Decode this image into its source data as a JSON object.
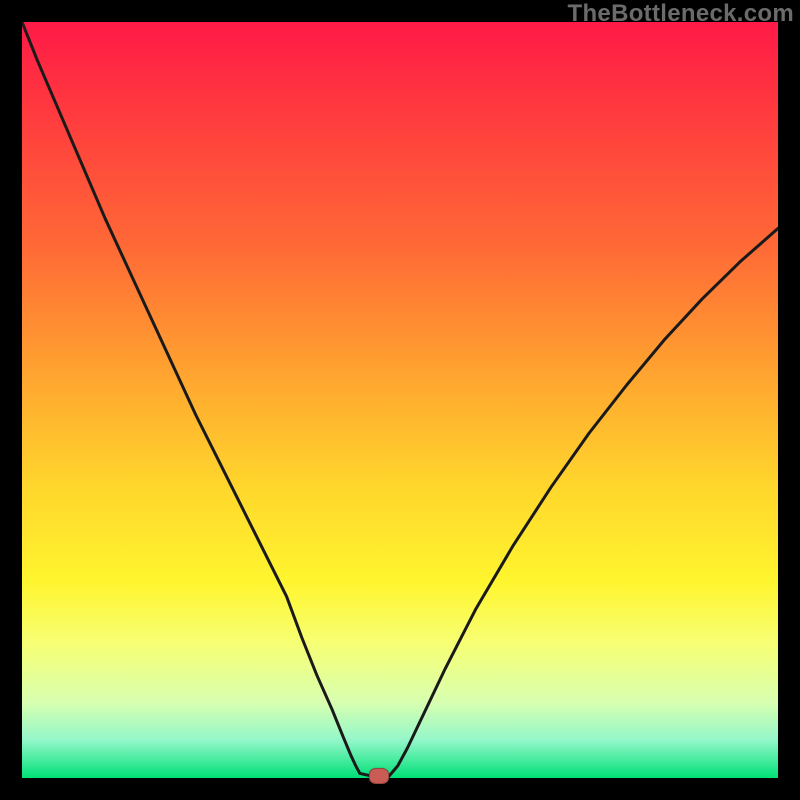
{
  "watermark": "TheBottleneck.com",
  "colors": {
    "gradient_top": "#ff1a47",
    "gradient_bottom": "#00e077",
    "curve_stroke": "#1a1a1a",
    "marker_fill": "#c95c55"
  },
  "chart_data": {
    "type": "line",
    "title": "",
    "xlabel": "",
    "ylabel": "",
    "xlim": [
      0,
      100
    ],
    "ylim": [
      0,
      100
    ],
    "grid": false,
    "legend": false,
    "series": [
      {
        "name": "left-branch",
        "x": [
          0,
          2,
          5,
          8,
          11,
          14,
          17,
          20,
          23,
          26,
          29,
          32,
          35,
          37,
          39,
          41,
          42.5,
          43.5,
          44.2,
          44.7
        ],
        "y": [
          100,
          95,
          88,
          81,
          74,
          67.5,
          61,
          54.5,
          48,
          42,
          36,
          30,
          24,
          18.6,
          13.6,
          9.1,
          5.4,
          3.0,
          1.5,
          0.6
        ]
      },
      {
        "name": "valley-floor",
        "x": [
          44.7,
          46.5,
          48.5
        ],
        "y": [
          0.6,
          0.2,
          0.2
        ]
      },
      {
        "name": "right-branch",
        "x": [
          48.5,
          49.7,
          51,
          53,
          56,
          60,
          65,
          70,
          75,
          80,
          85,
          90,
          95,
          100
        ],
        "y": [
          0.2,
          1.6,
          4.0,
          8.2,
          14.5,
          22.3,
          30.8,
          38.5,
          45.6,
          52.0,
          58.0,
          63.4,
          68.3,
          72.7
        ]
      }
    ],
    "annotations": [
      {
        "name": "minimum-marker",
        "x": 47.2,
        "y": 0.3
      }
    ]
  }
}
